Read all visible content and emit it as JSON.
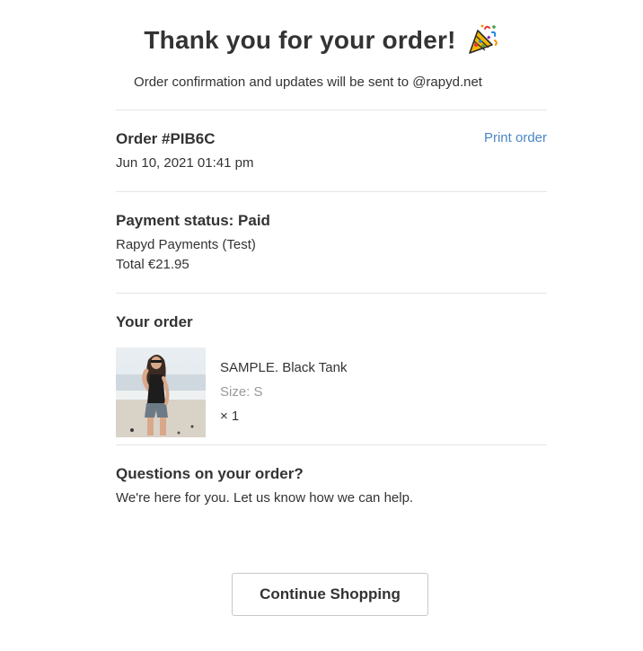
{
  "header": {
    "title": "Thank you for your order!",
    "icon": "party-popper-icon",
    "subtitle": "Order confirmation and updates will be sent to @rapyd.net"
  },
  "order": {
    "number": "Order #PIB6C",
    "date": "Jun 10, 2021 01:41 pm",
    "print_label": "Print order"
  },
  "payment": {
    "heading": "Payment status: Paid",
    "method": "Rapyd Payments (Test)",
    "total": "Total €21.95"
  },
  "your_order": {
    "heading": "Your order",
    "items": [
      {
        "name": "SAMPLE. Black Tank",
        "size": "Size: S",
        "quantity": "× 1",
        "image": "product-photo-woman-black-tank-beach"
      }
    ]
  },
  "questions": {
    "heading": "Questions on your order?",
    "text": "We're here for you. Let us know how we can help."
  },
  "actions": {
    "continue_label": "Continue Shopping"
  },
  "colors": {
    "link": "#4a86c5",
    "text": "#333333",
    "muted": "#999999",
    "divider": "#e4e4e4"
  }
}
